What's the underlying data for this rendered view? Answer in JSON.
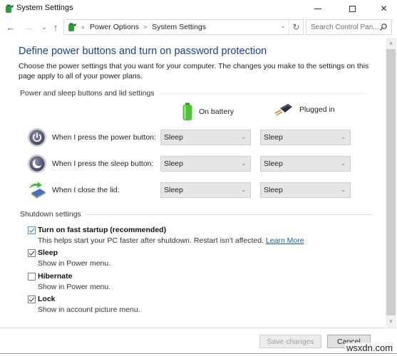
{
  "window": {
    "title": "System Settings",
    "controls": {
      "minimize": "minimize",
      "maximize": "maximize",
      "close": "close"
    }
  },
  "nav": {
    "back": "←",
    "forward": "→",
    "recent": "⌄",
    "up": "↑",
    "breadcrumb_overflow": "«",
    "breadcrumbs": [
      "Power Options",
      "System Settings"
    ],
    "separator": ">",
    "refresh": "↻",
    "dropdown": "⌄"
  },
  "search": {
    "placeholder": "Search Control Pan..."
  },
  "page": {
    "title": "Define power buttons and turn on password protection",
    "intro": "Choose the power settings that you want for your computer. The changes you make to the settings on this page apply to all of your power plans."
  },
  "power_section": {
    "header": "Power and sleep buttons and lid settings",
    "columns": {
      "battery": "On battery",
      "plugged": "Plugged in"
    },
    "rows": [
      {
        "label": "When I press the power button:",
        "icon": "power-button-icon",
        "battery": "Sleep",
        "plugged": "Sleep"
      },
      {
        "label": "When I press the sleep button:",
        "icon": "sleep-button-icon",
        "battery": "Sleep",
        "plugged": "Sleep"
      },
      {
        "label": "When I close the lid:",
        "icon": "laptop-lid-icon",
        "battery": "Sleep",
        "plugged": "Sleep"
      }
    ]
  },
  "shutdown_section": {
    "header": "Shutdown settings",
    "items": [
      {
        "label": "Turn on fast startup (recommended)",
        "description": "This helps start your PC faster after shutdown. Restart isn't affected.",
        "link": "Learn More",
        "checked": true
      },
      {
        "label": "Sleep",
        "description": "Show in Power menu.",
        "checked": true
      },
      {
        "label": "Hibernate",
        "description": "Show in Power menu.",
        "checked": false
      },
      {
        "label": "Lock",
        "description": "Show in account picture menu.",
        "checked": true
      }
    ]
  },
  "footer": {
    "save": "Save changes",
    "cancel": "Cancel"
  },
  "scrollbar": {
    "up": "˄",
    "down": "˅"
  },
  "watermark": "wsxdn.com"
}
